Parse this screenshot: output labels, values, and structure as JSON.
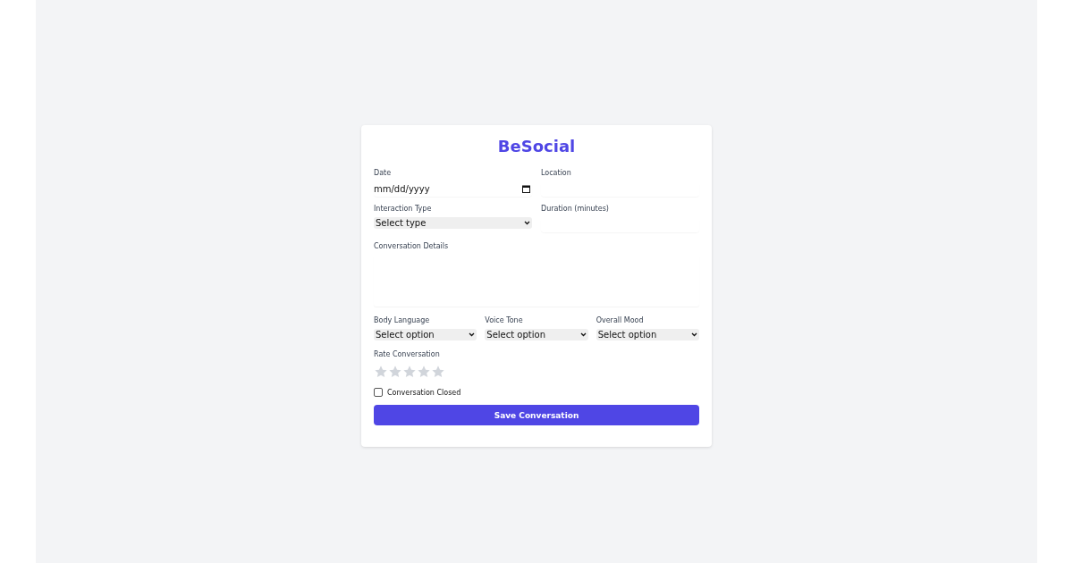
{
  "title": "BeSocial",
  "date": {
    "label": "Date",
    "placeholder": "mm/dd/yyyy"
  },
  "location": {
    "label": "Location"
  },
  "interaction_type": {
    "label": "Interaction Type",
    "value": "Select type"
  },
  "duration": {
    "label": "Duration (minutes)"
  },
  "details": {
    "label": "Conversation Details"
  },
  "selects": [
    {
      "label": "Body Language",
      "value": "Select option"
    },
    {
      "label": "Voice Tone",
      "value": "Select option"
    },
    {
      "label": "Overall Mood",
      "value": "Select option"
    }
  ],
  "rating": {
    "label": "Rate Conversation",
    "stars": 0
  },
  "closed": {
    "label": "Conversation Closed",
    "checked": false
  },
  "save_button": "Save Conversation"
}
